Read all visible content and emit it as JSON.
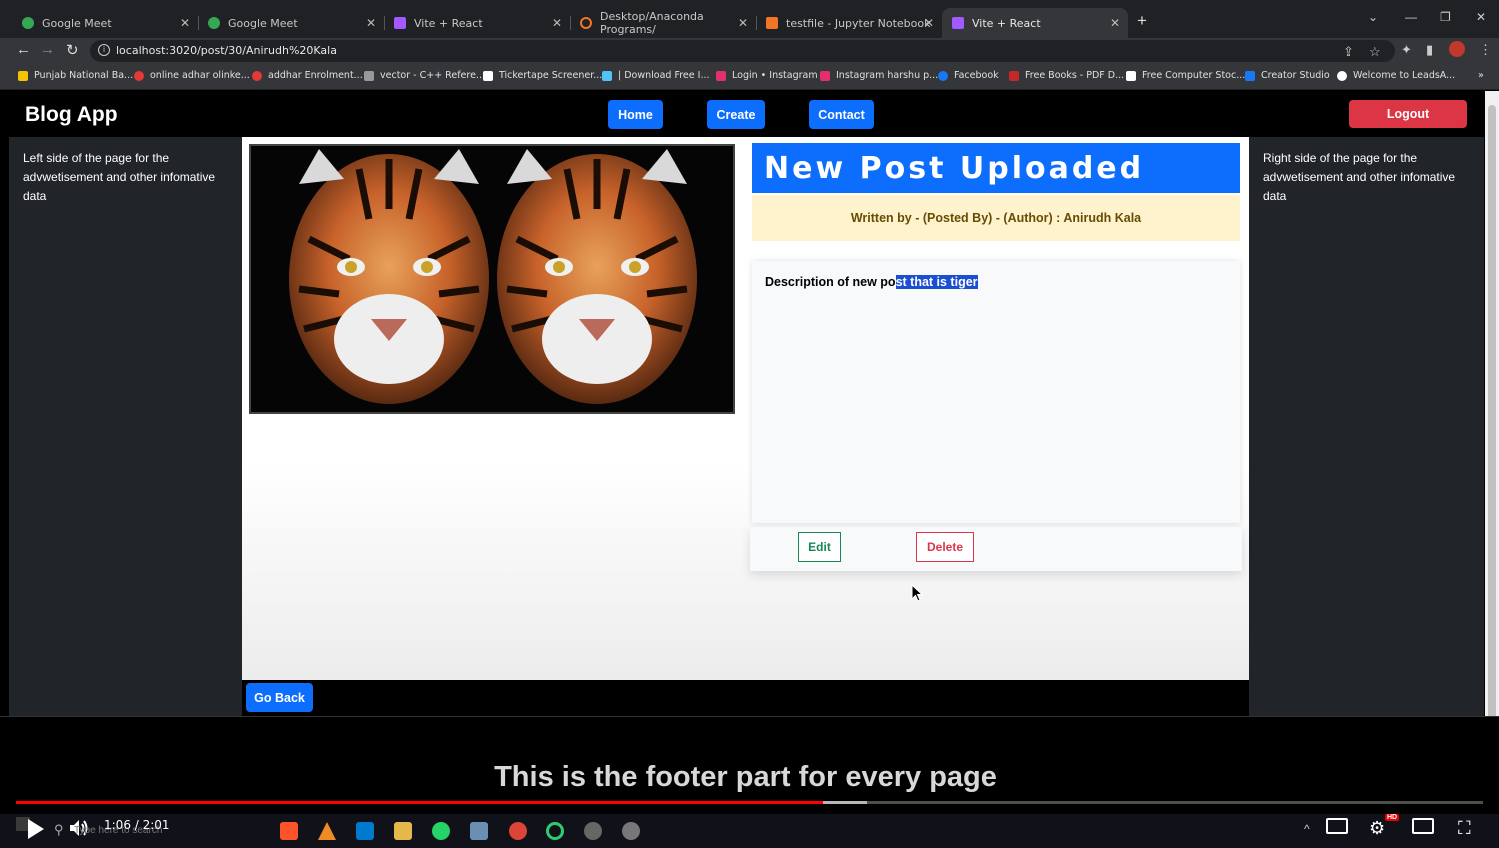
{
  "browser": {
    "tabs": [
      {
        "label": "Google Meet",
        "color": "#34a853",
        "active": false
      },
      {
        "label": "Google Meet",
        "color": "#34a853",
        "active": false
      },
      {
        "label": "Vite + React",
        "color": "#a259ff",
        "active": false
      },
      {
        "label": "Desktop/Anaconda Programs/",
        "color": "#f37626",
        "active": false
      },
      {
        "label": "testfile - Jupyter Notebook",
        "color": "#f37626",
        "active": false
      },
      {
        "label": "Vite + React",
        "color": "#a259ff",
        "active": true
      }
    ],
    "url": "localhost:3020/post/30/Anirudh%20Kala",
    "bookmarks": [
      {
        "label": "Punjab National Ba...",
        "color": "#f5c400"
      },
      {
        "label": "online adhar olinke...",
        "color": "#e53935"
      },
      {
        "label": "addhar Enrolment...",
        "color": "#e53935"
      },
      {
        "label": "vector - C++ Refere...",
        "color": "#999999"
      },
      {
        "label": "Tickertape Screener...",
        "color": "#ffffff"
      },
      {
        "label": "| Download Free I...",
        "color": "#4fc3f7"
      },
      {
        "label": "Login • Instagram",
        "color": "#e1306c"
      },
      {
        "label": "Instagram harshu p...",
        "color": "#e1306c"
      },
      {
        "label": "Facebook",
        "color": "#1877f2"
      },
      {
        "label": "Free Books - PDF D...",
        "color": "#c62828"
      },
      {
        "label": "Free Computer Stoc...",
        "color": "#ffffff"
      },
      {
        "label": "Creator Studio",
        "color": "#1877f2"
      },
      {
        "label": "Welcome to LeadsA...",
        "color": "#ffffff"
      }
    ]
  },
  "app": {
    "brand": "Blog App",
    "nav": {
      "home": "Home",
      "create": "Create",
      "contact": "Contact",
      "logout": "Logout"
    },
    "left_sidebar": "Left side of the page for the advwetisement and other infomative data",
    "right_sidebar": "Right side of the page for the advwetisement and other infomative data",
    "post": {
      "title": "New Post Uploaded",
      "author_line": "Written by - (Posted By) - (Author) : Anirudh Kala",
      "description_plain": "Description of new po",
      "description_selected": "st that is tiger",
      "edit_label": "Edit",
      "delete_label": "Delete"
    },
    "go_back": "Go Back",
    "footer": "This is the footer part for every page"
  },
  "video": {
    "time": "1:06 / 2:01",
    "progress": 0.55,
    "buffered": 0.58,
    "search_hint": "Type here to search"
  },
  "colors": {
    "primary": "#0d6efd",
    "danger": "#dc3545",
    "success": "#198754",
    "sidebar_bg": "#212529",
    "warning_bg": "#fff3cd"
  }
}
